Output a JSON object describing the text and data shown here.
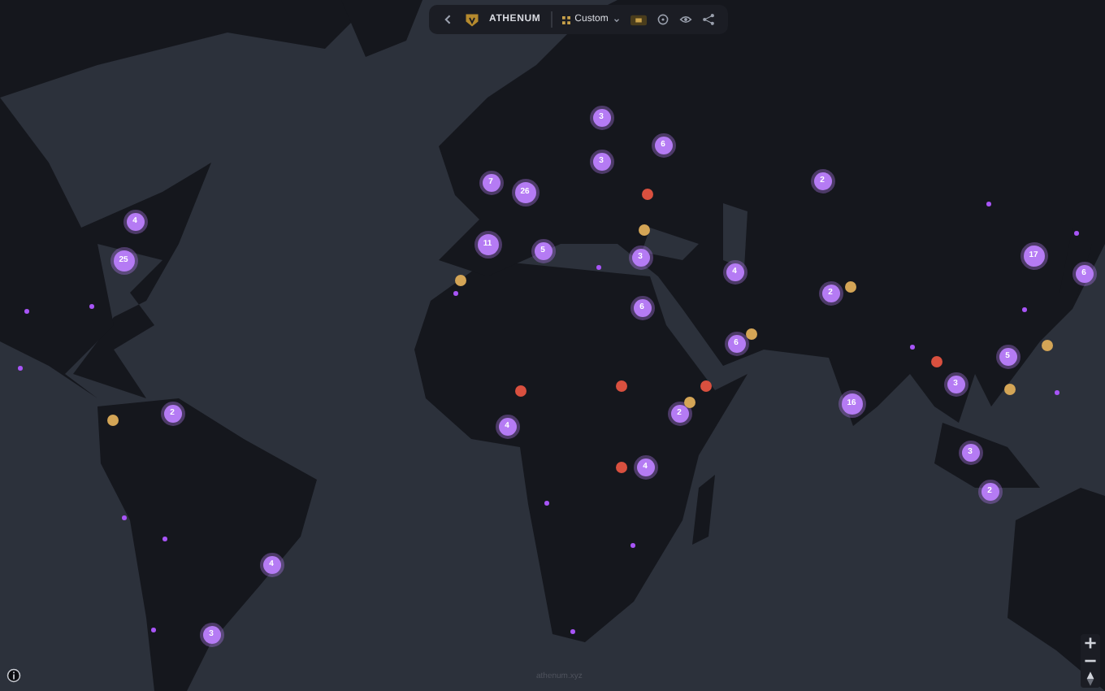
{
  "toolbar": {
    "brand": "ATHENUM",
    "view": "Custom"
  },
  "markers": [
    {
      "kind": "cluster",
      "count": "4"
    },
    {
      "kind": "cluster",
      "count": "25"
    },
    {
      "kind": "cluster",
      "count": "2"
    },
    {
      "kind": "cluster",
      "count": "4"
    },
    {
      "kind": "cluster",
      "count": "3"
    },
    {
      "kind": "cluster",
      "count": "7"
    },
    {
      "kind": "cluster",
      "count": "26"
    },
    {
      "kind": "cluster",
      "count": "11"
    },
    {
      "kind": "cluster",
      "count": "5"
    },
    {
      "kind": "cluster",
      "count": "3"
    },
    {
      "kind": "cluster",
      "count": "6"
    },
    {
      "kind": "cluster",
      "count": "3"
    },
    {
      "kind": "cluster",
      "count": "2"
    },
    {
      "kind": "cluster",
      "count": "3"
    },
    {
      "kind": "cluster",
      "count": "4"
    },
    {
      "kind": "cluster",
      "count": "2"
    },
    {
      "kind": "cluster",
      "count": "6"
    },
    {
      "kind": "cluster",
      "count": "6"
    },
    {
      "kind": "cluster",
      "count": "2"
    },
    {
      "kind": "cluster",
      "count": "4"
    },
    {
      "kind": "cluster",
      "count": "4"
    },
    {
      "kind": "cluster",
      "count": "16"
    },
    {
      "kind": "cluster",
      "count": "17"
    },
    {
      "kind": "cluster",
      "count": "6"
    },
    {
      "kind": "cluster",
      "count": "5"
    },
    {
      "kind": "cluster",
      "count": "3"
    },
    {
      "kind": "cluster",
      "count": "3"
    },
    {
      "kind": "cluster",
      "count": "2"
    },
    {
      "kind": "point",
      "color": "#a855f7"
    },
    {
      "kind": "point",
      "color": "#a855f7"
    },
    {
      "kind": "point",
      "color": "#a855f7"
    },
    {
      "kind": "point",
      "color": "#a855f7"
    },
    {
      "kind": "point",
      "color": "#a855f7"
    },
    {
      "kind": "point",
      "color": "#a855f7"
    },
    {
      "kind": "point",
      "color": "#a855f7"
    },
    {
      "kind": "point",
      "color": "#a855f7"
    },
    {
      "kind": "point",
      "color": "#a855f7"
    },
    {
      "kind": "point",
      "color": "#a855f7"
    },
    {
      "kind": "point",
      "color": "#a855f7"
    },
    {
      "kind": "point",
      "color": "#a855f7"
    },
    {
      "kind": "point",
      "color": "#a855f7"
    },
    {
      "kind": "point",
      "color": "#a855f7"
    },
    {
      "kind": "point",
      "color": "#a855f7"
    },
    {
      "kind": "point",
      "color": "#a855f7"
    },
    {
      "kind": "incident",
      "color": "#d4a556"
    },
    {
      "kind": "incident",
      "color": "#d4a556"
    },
    {
      "kind": "incident",
      "color": "#d4a556"
    },
    {
      "kind": "incident",
      "color": "#d4a556"
    },
    {
      "kind": "incident",
      "color": "#d4a556"
    },
    {
      "kind": "incident",
      "color": "#d4a556"
    },
    {
      "kind": "incident",
      "color": "#d4a556"
    },
    {
      "kind": "incident",
      "color": "#d4a556"
    },
    {
      "kind": "incident",
      "color": "#d9503f"
    },
    {
      "kind": "incident",
      "color": "#d9503f"
    },
    {
      "kind": "incident",
      "color": "#d9503f"
    },
    {
      "kind": "incident",
      "color": "#d9503f"
    },
    {
      "kind": "incident",
      "color": "#d9503f"
    },
    {
      "kind": "incident",
      "color": "#d9503f"
    }
  ],
  "attribution": "athenum.xyz"
}
